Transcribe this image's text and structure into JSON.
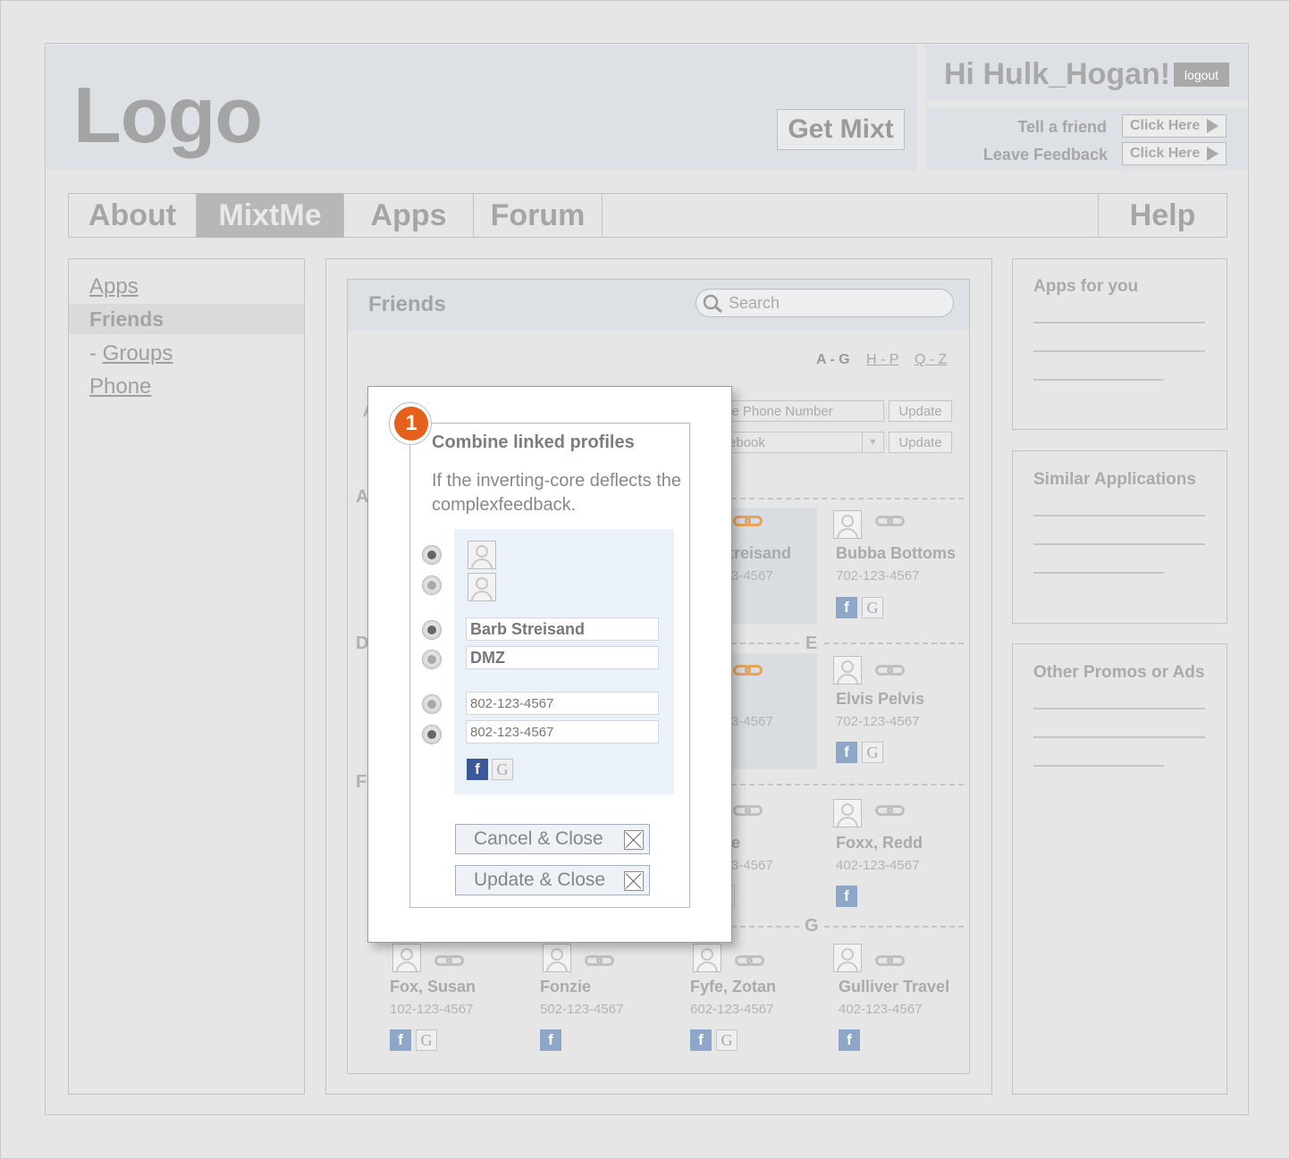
{
  "header": {
    "logo": "Logo",
    "get_mixt": "Get Mixt",
    "greeting": "Hi Hulk_Hogan!",
    "logout": "logout",
    "tell_friend": "Tell a friend",
    "leave_feedback": "Leave Feedback",
    "click_here": "Click Here"
  },
  "nav": {
    "tabs": [
      {
        "label": "About"
      },
      {
        "label": "MixtMe",
        "active": true
      },
      {
        "label": "Apps"
      },
      {
        "label": "Forum"
      }
    ],
    "help": "Help"
  },
  "sidebar": {
    "items": [
      {
        "label": "Apps"
      },
      {
        "label": "Friends",
        "active": true
      },
      {
        "label": "Groups",
        "prefix": "- "
      },
      {
        "label": "Phone"
      }
    ]
  },
  "friends": {
    "title": "Friends",
    "search_placeholder": "Search",
    "alpha_filters": [
      "A - G",
      "H - P",
      "Q - Z"
    ],
    "controls": {
      "phone_input": "le Phone Number",
      "source_select": "ebook",
      "update": "Update"
    },
    "section_letters": {
      "a": "A",
      "d": "D",
      "e": "E",
      "f": "F",
      "g": "G"
    },
    "cards": [
      {
        "name": "treisand",
        "phone": "3-4567"
      },
      {
        "name": "Bubba Bottoms",
        "phone": "702-123-4567"
      },
      {
        "name": "",
        "phone": "3-4567"
      },
      {
        "name": "Elvis Pelvis",
        "phone": "702-123-4567"
      },
      {
        "name": "e",
        "phone": "3-4567"
      },
      {
        "name": "Foxx, Redd",
        "phone": "402-123-4567"
      },
      {
        "name": "Fox, Susan",
        "phone": "102-123-4567"
      },
      {
        "name": "Fonzie",
        "phone": "502-123-4567"
      },
      {
        "name": "Fyfe, Zotan",
        "phone": "602-123-4567"
      },
      {
        "name": "Gulliver Travel",
        "phone": "402-123-4567"
      }
    ],
    "control_letter": "A"
  },
  "right": {
    "panels": [
      {
        "title": "Apps for you"
      },
      {
        "title": "Similar Applications"
      },
      {
        "title": "Other Promos or Ads"
      }
    ]
  },
  "modal": {
    "badge": "1",
    "title": "Combine linked profiles",
    "description": "If the inverting-core deflects the complexfeedback.",
    "name_options": [
      "Barb Streisand",
      "DMZ"
    ],
    "phone_options": [
      "802-123-4567",
      "802-123-4567"
    ],
    "cancel": "Cancel & Close",
    "update": "Update & Close",
    "fb": "f",
    "google": "G"
  },
  "colors": {
    "badge": "#e5601a",
    "link_orange": "#e5a35c",
    "facebook": "#8ea7c9"
  }
}
